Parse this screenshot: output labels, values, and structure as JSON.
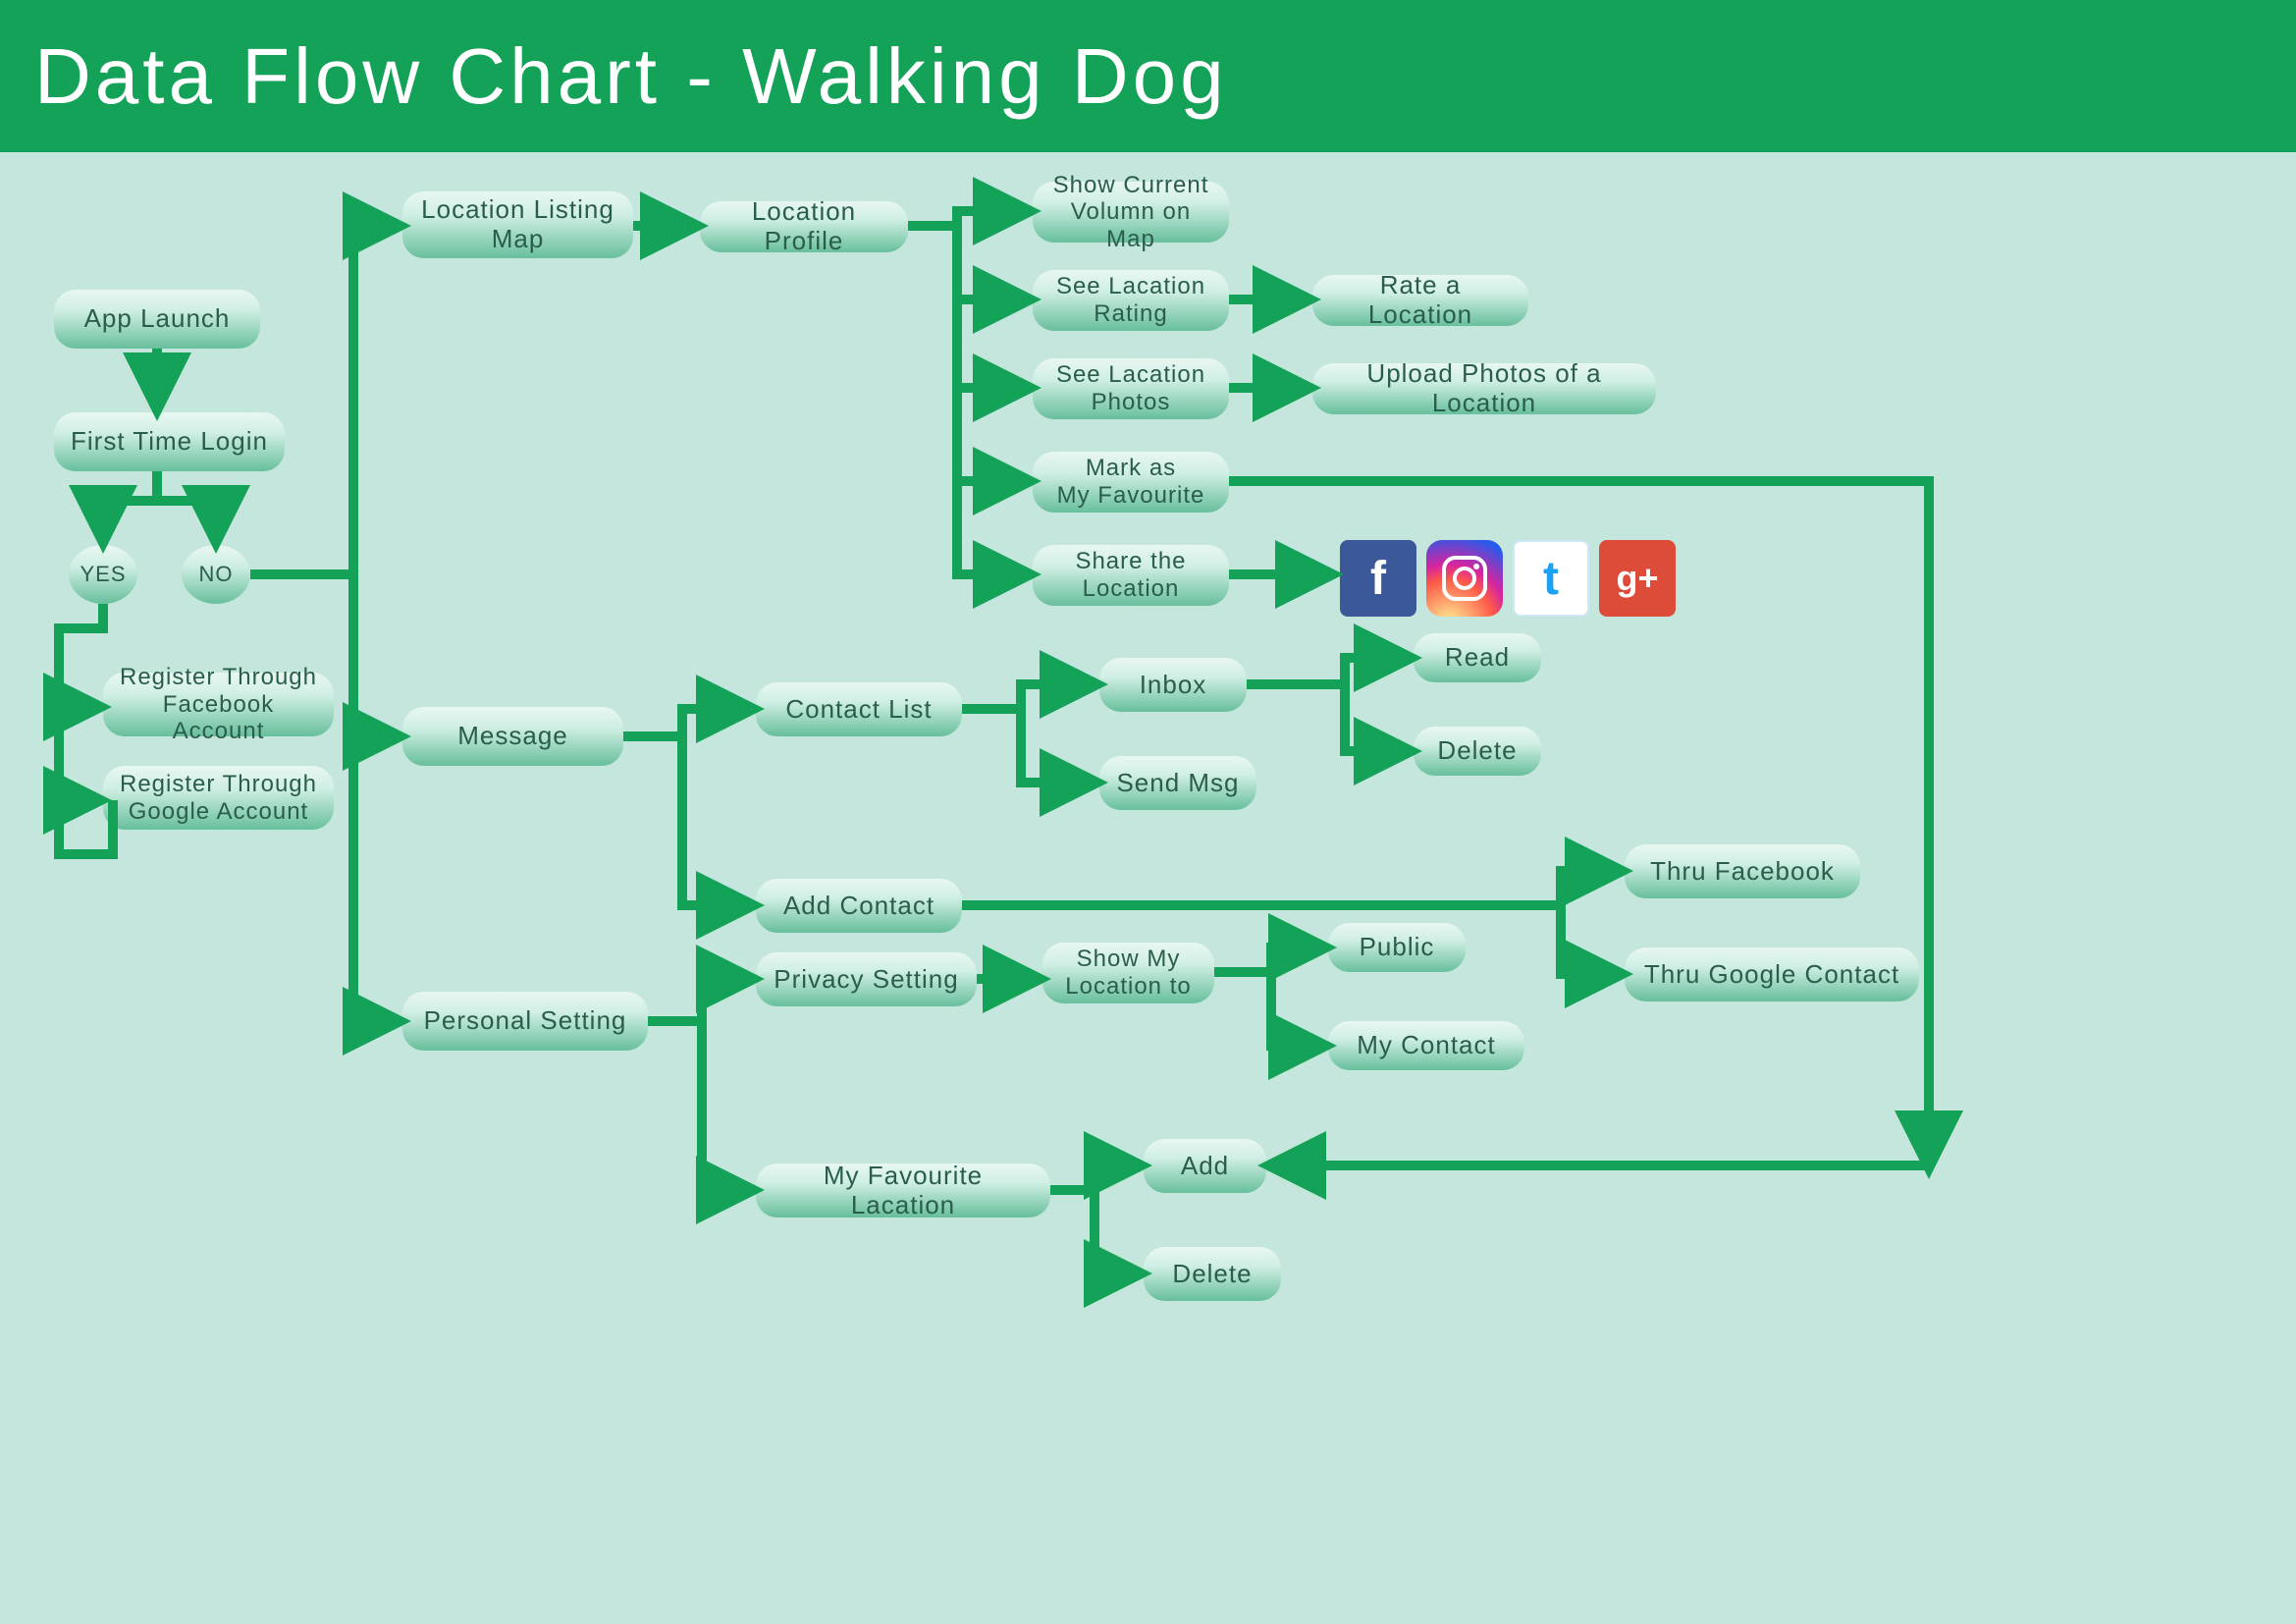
{
  "header": {
    "title": "Data Flow Chart - Walking Dog"
  },
  "nodes": {
    "appLaunch": "App Launch",
    "firstTimeLogin": "First Time Login",
    "yes": "YES",
    "no": "NO",
    "regFb": "Register Through\nFacebook Account",
    "regGoogle": "Register Through\nGoogle Account",
    "locListing": "Location Listing\nMap",
    "locProfile": "Location Profile",
    "showCurrent": "Show Current\nVolumn on Map",
    "seeRating": "See Lacation\nRating",
    "rateLoc": "Rate a Location",
    "seePhotos": "See Lacation\nPhotos",
    "uploadPhotos": "Upload Photos of a Location",
    "markFav": "Mark as\nMy Favourite",
    "shareLoc": "Share the\nLocation",
    "message": "Message",
    "contactList": "Contact List",
    "inbox": "Inbox",
    "sendMsg": "Send Msg",
    "read": "Read",
    "delete1": "Delete",
    "addContact": "Add Contact",
    "thruFb": "Thru Facebook",
    "thruGoogle": "Thru Google Contact",
    "personalSetting": "Personal Setting",
    "privacySetting": "Privacy Setting",
    "showMyLoc": "Show My\nLocation to",
    "public": "Public",
    "myContact": "My Contact",
    "myFavLoc": "My Favourite Lacation",
    "add": "Add",
    "delete2": "Delete"
  },
  "social": [
    "facebook",
    "instagram",
    "twitter",
    "googleplus"
  ]
}
